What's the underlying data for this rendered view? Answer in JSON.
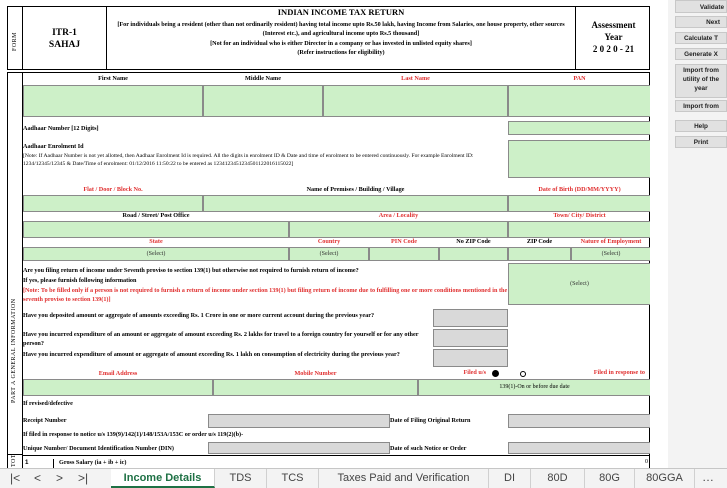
{
  "header": {
    "form_label": "FORM",
    "itr_line1": "ITR-1",
    "itr_line2": "SAHAJ",
    "title": "INDIAN INCOME TAX RETURN",
    "desc1": "[For individuals being a resident (other than not ordinarily resident) having total income upto Rs.50 lakh, having Income from Salaries, one house property, other sources (Interest etc.), and agricultural income upto Rs.5 thousand]",
    "desc2": "[Not for an individual who is either Director in a company or has invested in unlisted equity shares]",
    "desc3": "(Refer instructions for eligibility)",
    "ay_label1": "Assessment",
    "ay_label2": "Year",
    "ay_value": "2 0 2 0 - 21"
  },
  "side_labels": {
    "part_a": "PART A GENERAL INFORMATION",
    "bottom": "TOT"
  },
  "fields": {
    "first_name": "First Name",
    "middle_name": "Middle Name",
    "last_name": "Last Name",
    "pan": "PAN",
    "aadhaar": "Aadhaar Number [12 Digits]",
    "enrol_title": "Aadhaar Enrolment Id",
    "enrol_note": "[Note: If Aadhaar Number is not yet allotted, then Aadhaar Enrolment Id is required. All the digits in enrolment ID & Date and time of enrolment to be entered continuously. For example Enrolment ID: 1234/12345/12345 & Date/Time of enrolment: 01/12/2016 11:50:22 to be entered as 1234123451234501122016115022]",
    "flat": "Flat / Door / Block No.",
    "premises": "Name of Premises / Building / Village",
    "dob": "Date of Birth (DD/MM/YYYY)",
    "road": "Road / Street/ Post Office",
    "area": "Area / Locality",
    "town": "Town/ City/ District",
    "state": "State",
    "country": "Country",
    "pin": "PIN Code",
    "nozip": "No ZIP Code",
    "zip": "ZIP Code",
    "employment": "Nature of Employment",
    "select": "(Select)",
    "q139": "Are you filing return of income under Seventh proviso to section 139(1) but otherwise not required to furnish return of income?",
    "q139b": "If yes, please furnish following information",
    "q139note": "[Note: To be filled only if a person is not required to furnish a return of income under section 139(1) but filing return of income due to fulfilling one or more conditions mentioned in the seventh proviso to section 139(1)]",
    "q_deposit": "Have you deposited amount or aggregate of amounts exceeding Rs. 1 Crore in one or more current account during the previous year?",
    "q_travel": "Have you incurred expenditure of an amount or aggregate of amount exceeding Rs. 2 lakhs for travel to a foreign country for yourself or for any other person?",
    "q_elec": "Have you incurred expenditure of amount or aggregate of amount exceeding Rs. 1 lakh on consumption of electricity during the previous year?",
    "email": "Email Address",
    "mobile": "Mobile Number",
    "filed_us": "Filed u/s",
    "filed_resp": "Filed in response to",
    "filed_opt": "139(1)-On or before due date",
    "revised": "If revised/defective",
    "receipt": "Receipt Number",
    "filing_date": "Date of Filing Original Return",
    "notice": "If filed in response to notice u/s 139(9)/142(1)/148/153A/153C or order u/s 119(2)(b)-",
    "din": "Unique Number/ Document Identification Number (DIN)",
    "notice_date": "Date of such Notice or Order",
    "row_num": "1",
    "gross": "Gross Salary (ia + ib + ic)",
    "gross_val": "0"
  },
  "pane": {
    "buttons": [
      "Validate",
      "Next",
      "Calculate T",
      "Generate X",
      "Import from utility of the year",
      "Import from",
      "Help",
      "Print"
    ]
  },
  "tabs": {
    "items": [
      "Income Details",
      "TDS",
      "TCS",
      "Taxes Paid and Verification",
      "DI",
      "80D",
      "80G",
      "80GGA"
    ],
    "active": "Income Details"
  },
  "colors": {
    "green_fill": "#cdf0c8",
    "grey_fill": "#d9d9d9",
    "red_label": "#e03030",
    "tab_active": "#1e7145"
  }
}
